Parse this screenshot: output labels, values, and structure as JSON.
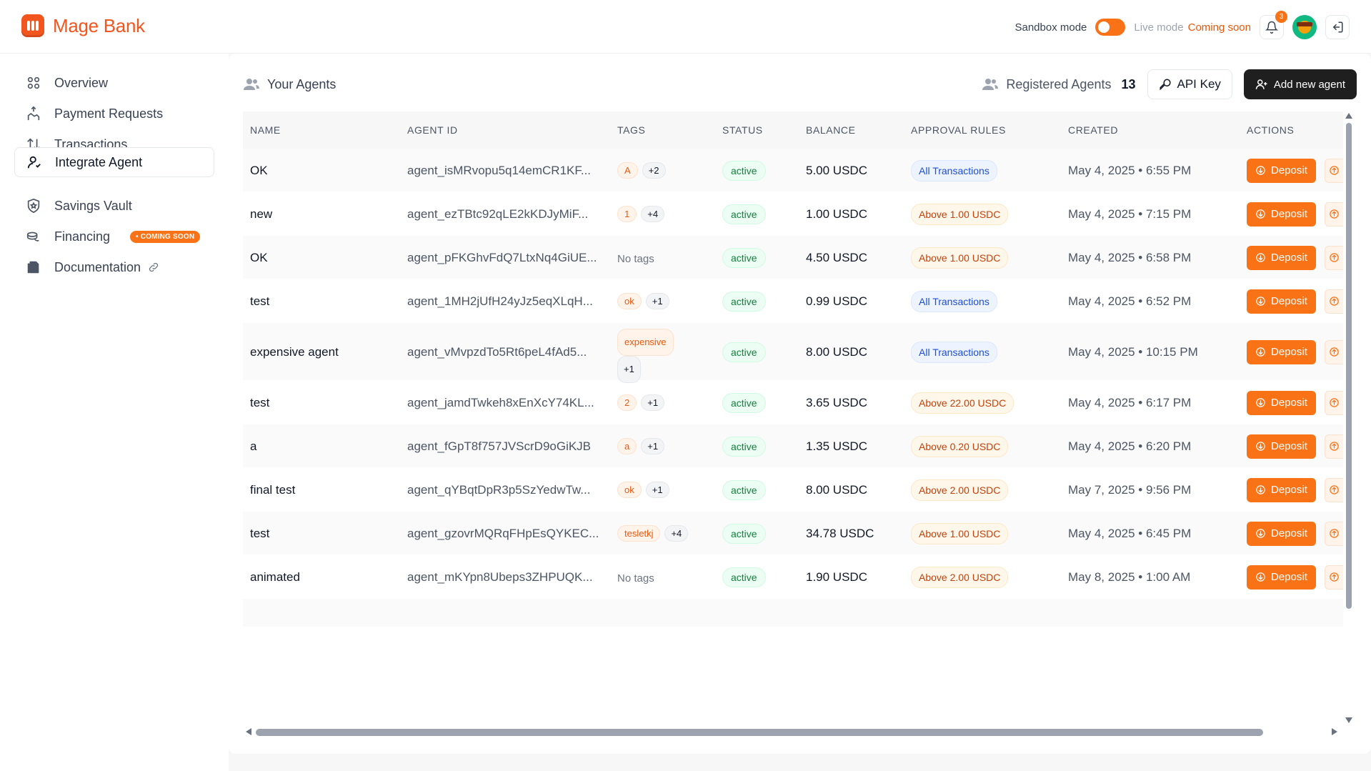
{
  "app": {
    "name": "Mage Bank"
  },
  "topbar": {
    "sandbox_label": "Sandbox mode",
    "live_label": "Live mode",
    "coming_soon": "Coming soon",
    "notifications_count": "3"
  },
  "sidebar": {
    "items": [
      {
        "label": "Overview",
        "icon": "grid-icon"
      },
      {
        "label": "Payment Requests",
        "icon": "hand-coin-icon"
      },
      {
        "label": "Transactions",
        "icon": "arrows-updown-icon"
      },
      {
        "label": "Integrate Agent",
        "icon": "user-icon",
        "active": true
      },
      {
        "label": "Savings Vault",
        "icon": "shield-icon"
      },
      {
        "label": "Financing",
        "icon": "coins-icon",
        "badge": "• COMING SOON"
      },
      {
        "label": "Documentation",
        "icon": "docs-icon"
      }
    ]
  },
  "main": {
    "title": "Your Agents",
    "registered_label": "Registered Agents",
    "registered_count": "13",
    "api_key_label": "API Key",
    "add_agent_label": "Add new agent"
  },
  "table": {
    "columns": [
      "NAME",
      "AGENT ID",
      "TAGS",
      "STATUS",
      "BALANCE",
      "APPROVAL RULES",
      "CREATED",
      "ACTIONS"
    ],
    "deposit_label": "Deposit",
    "no_tags_label": "No tags",
    "rows": [
      {
        "name": "OK",
        "agent_id": "agent_isMRvopu5q14emCR1KF...",
        "tags": [
          "A"
        ],
        "more": "+2",
        "status": "active",
        "balance": "5.00 USDC",
        "rule": "All Transactions",
        "rule_kind": "blue",
        "created_date": "May 4, 2025",
        "created_time": "6:55 PM"
      },
      {
        "name": "new",
        "agent_id": "agent_ezTBtc92qLE2kKDJyMiF...",
        "tags": [
          "1"
        ],
        "more": "+4",
        "status": "active",
        "balance": "1.00 USDC",
        "rule": "Above 1.00 USDC",
        "rule_kind": "orange",
        "created_date": "May 4, 2025",
        "created_time": "7:15 PM"
      },
      {
        "name": "OK",
        "agent_id": "agent_pFKGhvFdQ7LtxNq4GiUE...",
        "tags": [],
        "more": "",
        "status": "active",
        "balance": "4.50 USDC",
        "rule": "Above 1.00 USDC",
        "rule_kind": "orange",
        "created_date": "May 4, 2025",
        "created_time": "6:58 PM"
      },
      {
        "name": "test",
        "agent_id": "agent_1MH2jUfH24yJz5eqXLqH...",
        "tags": [
          "ok"
        ],
        "more": "+1",
        "status": "active",
        "balance": "0.99 USDC",
        "rule": "All Transactions",
        "rule_kind": "blue",
        "created_date": "May 4, 2025",
        "created_time": "6:52 PM"
      },
      {
        "name": "expensive agent",
        "agent_id": "agent_vMvpzdTo5Rt6peL4fAd5...",
        "tags": [
          "expensive"
        ],
        "more": "+1",
        "status": "active",
        "balance": "8.00 USDC",
        "rule": "All Transactions",
        "rule_kind": "blue",
        "created_date": "May 4, 2025",
        "created_time": "10:15 PM",
        "tall": true
      },
      {
        "name": "test",
        "agent_id": "agent_jamdTwkeh8xEnXcY74KL...",
        "tags": [
          "2"
        ],
        "more": "+1",
        "status": "active",
        "balance": "3.65 USDC",
        "rule": "Above 22.00 USDC",
        "rule_kind": "orange",
        "created_date": "May 4, 2025",
        "created_time": "6:17 PM"
      },
      {
        "name": "a",
        "agent_id": "agent_fGpT8f757JVScrD9oGiKJB",
        "tags": [
          "a"
        ],
        "more": "+1",
        "status": "active",
        "balance": "1.35 USDC",
        "rule": "Above 0.20 USDC",
        "rule_kind": "orange",
        "created_date": "May 4, 2025",
        "created_time": "6:20 PM"
      },
      {
        "name": "final test",
        "agent_id": "agent_qYBqtDpR3p5SzYedwTw...",
        "tags": [
          "ok"
        ],
        "more": "+1",
        "status": "active",
        "balance": "8.00 USDC",
        "rule": "Above 2.00 USDC",
        "rule_kind": "orange",
        "created_date": "May 7, 2025",
        "created_time": "9:56 PM"
      },
      {
        "name": "test",
        "agent_id": "agent_gzovrMQRqFHpEsQYKEC...",
        "tags": [
          "tesletkj"
        ],
        "more": "+4",
        "status": "active",
        "balance": "34.78 USDC",
        "rule": "Above 1.00 USDC",
        "rule_kind": "orange",
        "created_date": "May 4, 2025",
        "created_time": "6:45 PM"
      },
      {
        "name": "animated",
        "agent_id": "agent_mKYpn8Ubeps3ZHPUQK...",
        "tags": [],
        "more": "",
        "status": "active",
        "balance": "1.90 USDC",
        "rule": "Above 2.00 USDC",
        "rule_kind": "orange",
        "created_date": "May 8, 2025",
        "created_time": "1:00 AM"
      }
    ]
  },
  "colors": {
    "brand": "#f2551e",
    "accent": "#f97316",
    "active_green": "#15803d",
    "rule_blue": "#1d4ed8"
  }
}
